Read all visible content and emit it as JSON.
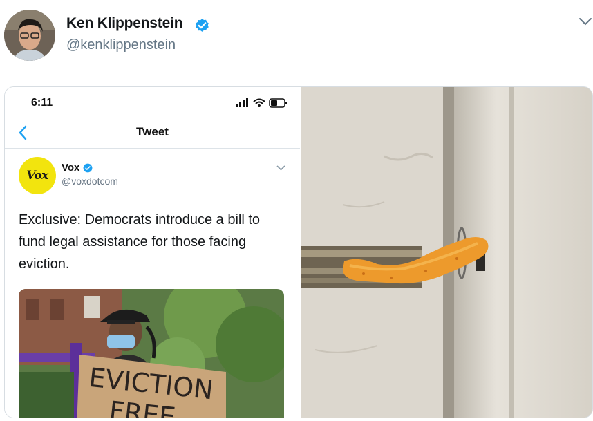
{
  "author": {
    "name": "Ken Klippenstein",
    "handle": "@kenklippenstein",
    "verified": true,
    "avatar_icon": "avatar-photo"
  },
  "media": {
    "screenshot": {
      "status_bar": {
        "time": "6:11"
      },
      "nav": {
        "title": "Tweet"
      },
      "quoted_tweet": {
        "logo_text": "Vox",
        "name": "Vox",
        "handle": "@voxdotcom",
        "verified": true,
        "text": "Exclusive: Democrats introduce a bill to fund legal assistance for those facing eviction.",
        "photo": {
          "sign_line_1": "EVICTION",
          "sign_line_2": "FREE"
        }
      }
    },
    "photo_description_icon": "cheeto-door-latch-photo"
  },
  "colors": {
    "verified_blue": "#1da1f2",
    "vox_yellow": "#f2e40e",
    "handle_gray": "#657786"
  }
}
